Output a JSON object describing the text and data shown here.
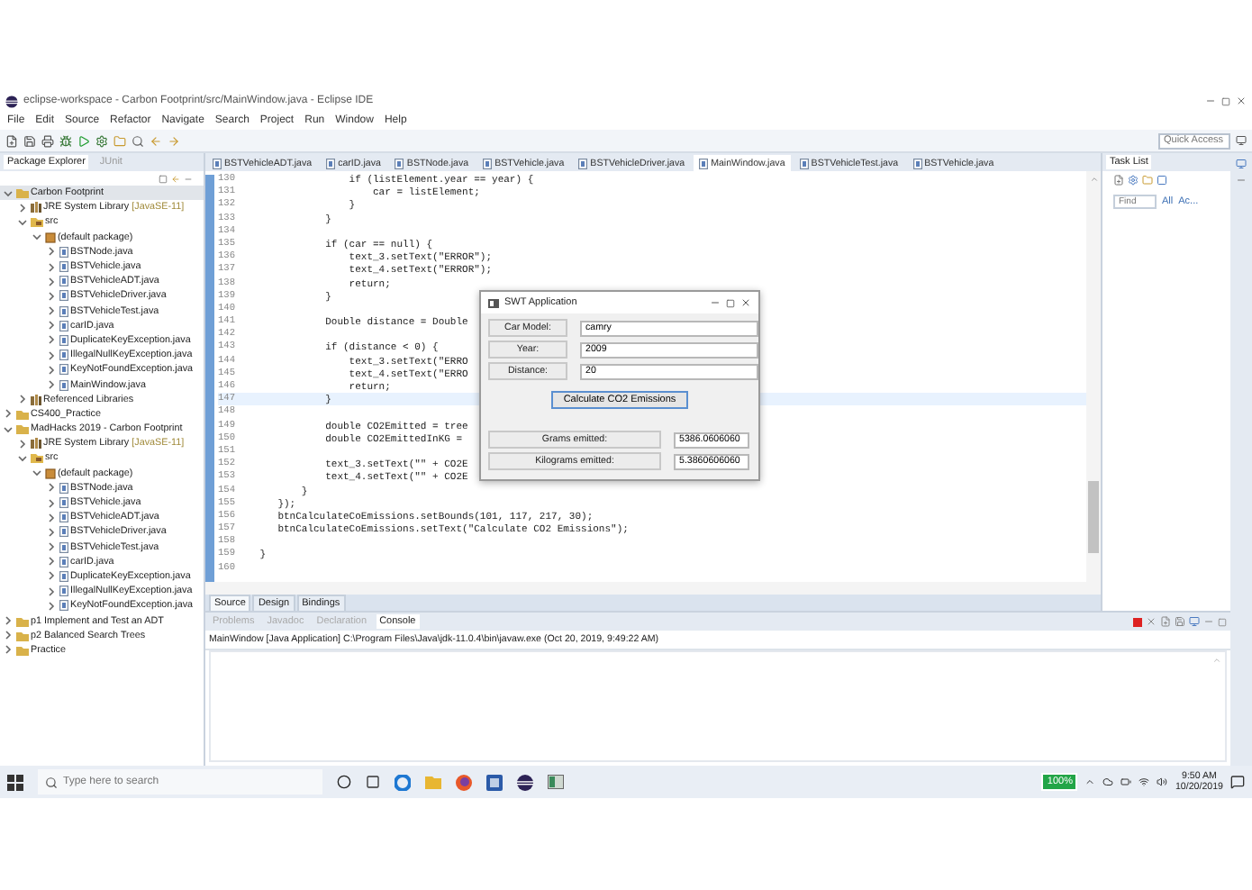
{
  "window": {
    "title": "eclipse-workspace - Carbon Footprint/src/MainWindow.java - Eclipse IDE"
  },
  "menu": [
    "File",
    "Edit",
    "Source",
    "Refactor",
    "Navigate",
    "Search",
    "Project",
    "Run",
    "Window",
    "Help"
  ],
  "toolbar": {
    "quick_access": {
      "placeholder": "Quick Access"
    }
  },
  "explorer": {
    "tabs": [
      {
        "label": "Package Explorer",
        "selected": true
      },
      {
        "label": "JUnit",
        "selected": false
      }
    ],
    "tree": [
      {
        "label": "Carbon Footprint",
        "kind": "project",
        "expanded": true,
        "selected": true,
        "children": [
          {
            "label": "JRE System Library",
            "decoration": "[JavaSE-11]",
            "kind": "library",
            "expanded": false,
            "selected": false
          },
          {
            "label": "src",
            "kind": "folder",
            "expanded": true,
            "selected": false,
            "children": [
              {
                "label": "(default package)",
                "kind": "package",
                "expanded": true,
                "selected": false,
                "children": [
                  {
                    "label": "BSTNode.java",
                    "kind": "file",
                    "expanded": false,
                    "selected": false
                  },
                  {
                    "label": "BSTVehicle.java",
                    "kind": "file",
                    "expanded": false,
                    "selected": false
                  },
                  {
                    "label": "BSTVehicleADT.java",
                    "kind": "file",
                    "expanded": false,
                    "selected": false
                  },
                  {
                    "label": "BSTVehicleDriver.java",
                    "kind": "file",
                    "expanded": false,
                    "selected": false
                  },
                  {
                    "label": "BSTVehicleTest.java",
                    "kind": "file",
                    "expanded": false,
                    "selected": false
                  },
                  {
                    "label": "carID.java",
                    "kind": "file",
                    "expanded": false,
                    "selected": false
                  },
                  {
                    "label": "DuplicateKeyException.java",
                    "kind": "file",
                    "expanded": false,
                    "selected": false
                  },
                  {
                    "label": "IllegalNullKeyException.java",
                    "kind": "file",
                    "expanded": false,
                    "selected": false
                  },
                  {
                    "label": "KeyNotFoundException.java",
                    "kind": "file",
                    "expanded": false,
                    "selected": false
                  },
                  {
                    "label": "MainWindow.java",
                    "kind": "file",
                    "expanded": false,
                    "selected": false
                  }
                ]
              }
            ]
          },
          {
            "label": "Referenced Libraries",
            "kind": "library",
            "expanded": false,
            "selected": false
          }
        ]
      },
      {
        "label": "CS400_Practice",
        "kind": "project",
        "expanded": false,
        "selected": false
      },
      {
        "label": "MadHacks 2019 - Carbon Footprint",
        "kind": "project",
        "expanded": true,
        "selected": false,
        "children": [
          {
            "label": "JRE System Library",
            "decoration": "[JavaSE-11]",
            "kind": "library",
            "expanded": false,
            "selected": false
          },
          {
            "label": "src",
            "kind": "folder",
            "expanded": true,
            "selected": false,
            "children": [
              {
                "label": "(default package)",
                "kind": "package",
                "expanded": true,
                "selected": false,
                "children": [
                  {
                    "label": "BSTNode.java",
                    "kind": "file",
                    "expanded": false,
                    "selected": false
                  },
                  {
                    "label": "BSTVehicle.java",
                    "kind": "file",
                    "expanded": false,
                    "selected": false
                  },
                  {
                    "label": "BSTVehicleADT.java",
                    "kind": "file",
                    "expanded": false,
                    "selected": false
                  },
                  {
                    "label": "BSTVehicleDriver.java",
                    "kind": "file",
                    "expanded": false,
                    "selected": false
                  },
                  {
                    "label": "BSTVehicleTest.java",
                    "kind": "file",
                    "expanded": false,
                    "selected": false
                  },
                  {
                    "label": "carID.java",
                    "kind": "file",
                    "expanded": false,
                    "selected": false
                  },
                  {
                    "label": "DuplicateKeyException.java",
                    "kind": "file",
                    "expanded": false,
                    "selected": false
                  },
                  {
                    "label": "IllegalNullKeyException.java",
                    "kind": "file",
                    "expanded": false,
                    "selected": false
                  },
                  {
                    "label": "KeyNotFoundException.java",
                    "kind": "file",
                    "expanded": false,
                    "selected": false
                  }
                ]
              }
            ]
          }
        ]
      },
      {
        "label": "p1 Implement and Test an ADT",
        "kind": "project",
        "expanded": false,
        "selected": false
      },
      {
        "label": "p2 Balanced Search Trees",
        "kind": "project",
        "expanded": false,
        "selected": false
      },
      {
        "label": "Practice",
        "kind": "project",
        "expanded": false,
        "selected": false
      }
    ]
  },
  "editor": {
    "tabs": [
      {
        "label": "BSTVehicleADT.java",
        "selected": false
      },
      {
        "label": "carID.java",
        "selected": false
      },
      {
        "label": "BSTNode.java",
        "selected": false
      },
      {
        "label": "BSTVehicle.java",
        "selected": false
      },
      {
        "label": "BSTVehicleDriver.java",
        "selected": false
      },
      {
        "label": "MainWindow.java",
        "selected": true
      },
      {
        "label": "BSTVehicleTest.java",
        "selected": false
      },
      {
        "label": "BSTVehicle.java",
        "selected": false
      }
    ],
    "lines": [
      {
        "number": "130",
        "text": "                if (listElement.year == year) {",
        "current": false
      },
      {
        "number": "131",
        "text": "                    car = listElement;",
        "current": false
      },
      {
        "number": "132",
        "text": "                }",
        "current": false
      },
      {
        "number": "133",
        "text": "            }",
        "current": false
      },
      {
        "number": "134",
        "current": false
      },
      {
        "number": "135",
        "text": "            if (car == null) {",
        "current": false
      },
      {
        "number": "136",
        "text": "                text_3.setText(\"ERROR\");",
        "current": false
      },
      {
        "number": "137",
        "text": "                text_4.setText(\"ERROR\");",
        "current": false
      },
      {
        "number": "138",
        "text": "                return;",
        "current": false
      },
      {
        "number": "139",
        "text": "            }",
        "current": false
      },
      {
        "number": "140",
        "current": false
      },
      {
        "number": "141",
        "text": "            Double distance = Double",
        "current": false
      },
      {
        "number": "142",
        "current": false
      },
      {
        "number": "143",
        "text": "            if (distance < 0) {",
        "current": false
      },
      {
        "number": "144",
        "text": "                text_3.setText(\"ERRO",
        "current": false
      },
      {
        "number": "145",
        "text": "                text_4.setText(\"ERRO",
        "current": false
      },
      {
        "number": "146",
        "text": "                return;",
        "current": false
      },
      {
        "number": "147",
        "text": "            }",
        "current": true
      },
      {
        "number": "148",
        "current": false
      },
      {
        "number": "149",
        "text": "            double CO2Emitted = tree",
        "current": false
      },
      {
        "number": "150",
        "text": "            double CO2EmittedInKG =",
        "current": false
      },
      {
        "number": "151",
        "current": false
      },
      {
        "number": "152",
        "text": "            text_3.setText(\"\" + CO2E",
        "current": false
      },
      {
        "number": "153",
        "text": "            text_4.setText(\"\" + CO2E",
        "current": false
      },
      {
        "number": "154",
        "text": "        }",
        "current": false
      },
      {
        "number": "155",
        "text": "    });",
        "current": false
      },
      {
        "number": "156",
        "text": "    btnCalculateCoEmissions.setBounds(101, 117, 217, 30);",
        "current": false
      },
      {
        "number": "157",
        "text": "    btnCalculateCoEmissions.setText(\"Calculate CO2 Emissions\");",
        "current": false
      },
      {
        "number": "158",
        "current": false
      },
      {
        "number": "159",
        "text": " }",
        "current": false
      },
      {
        "number": "160",
        "current": false
      }
    ],
    "view_tabs": [
      {
        "label": "Source",
        "selected": true
      },
      {
        "label": "Design",
        "selected": false
      },
      {
        "label": "Bindings",
        "selected": false
      }
    ]
  },
  "dialog": {
    "title": "SWT Application",
    "inputs": [
      {
        "label": "Car Model:",
        "value": "camry"
      },
      {
        "label": "Year:",
        "value": "2009"
      },
      {
        "label": "Distance:",
        "value": "20"
      }
    ],
    "button": "Calculate CO2 Emissions",
    "outputs": [
      {
        "label": "Grams emitted:",
        "value": "5386.0606060"
      },
      {
        "label": "Kilograms emitted:",
        "value": "5.3860606060"
      }
    ]
  },
  "task_list": {
    "title": "Task List",
    "find": {
      "placeholder": "Find"
    },
    "links": [
      "All",
      "Ac..."
    ]
  },
  "console": {
    "tabs": [
      {
        "label": "Problems",
        "selected": false
      },
      {
        "label": "Javadoc",
        "selected": false
      },
      {
        "label": "Declaration",
        "selected": false
      },
      {
        "label": "Console",
        "selected": true
      }
    ],
    "header": "MainWindow [Java Application] C:\\Program Files\\Java\\jdk-11.0.4\\bin\\javaw.exe (Oct 20, 2019, 9:49:22 AM)"
  },
  "taskbar": {
    "search": {
      "placeholder": "Type here to search"
    },
    "battery": "100%",
    "time": "9:50 AM",
    "date": "10/20/2019"
  }
}
